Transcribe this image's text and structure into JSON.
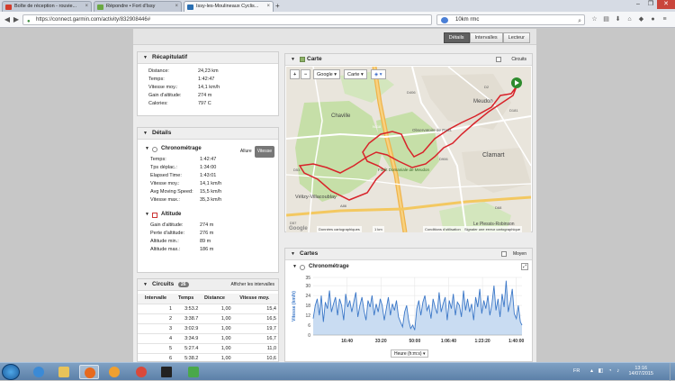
{
  "browser": {
    "tabs": [
      {
        "label": "Boîte de réception - rouvie...",
        "color": "#d23c2c"
      },
      {
        "label": "Répondre • Fort d'Issy",
        "color": "#6aa843"
      },
      {
        "label": "Issy-les-Moulineaux Cyclis...",
        "color": "#2a6fb2"
      }
    ],
    "new_tab": "+",
    "url": "https://connect.garmin.com/activity/832908446#",
    "search": "10km rmc",
    "win_min": "–",
    "win_max": "❐",
    "win_close": "✕"
  },
  "view_buttons": [
    "Détails",
    "Intervalles",
    "Lecteur"
  ],
  "recap": {
    "title": "Récapitulatif",
    "rows": [
      {
        "k": "Distance:",
        "v": "24,23 km"
      },
      {
        "k": "Temps:",
        "v": "1:42:47"
      },
      {
        "k": "Vitesse moy.:",
        "v": "14,1 km/h"
      },
      {
        "k": "Gain d'altitude:",
        "v": "274 m"
      },
      {
        "k": "Calories:",
        "v": "797 C"
      }
    ]
  },
  "details": {
    "title": "Détails",
    "chrono": {
      "title": "Chronométrage",
      "toggle": [
        "Allure",
        "Vitesse"
      ],
      "rows": [
        {
          "k": "Temps:",
          "v": "1:42:47"
        },
        {
          "k": "Tps déplac.:",
          "v": "1:34:00"
        },
        {
          "k": "Elapsed Time:",
          "v": "1:43:01"
        },
        {
          "k": "Vitesse moy.:",
          "v": "14,1 km/h"
        },
        {
          "k": "Avg Moving Speed:",
          "v": "15,5 km/h"
        },
        {
          "k": "Vitesse max.:",
          "v": "35,3 km/h"
        }
      ]
    },
    "altitude": {
      "title": "Altitude",
      "rows": [
        {
          "k": "Gain d'altitude:",
          "v": "274 m"
        },
        {
          "k": "Perte d'altitude:",
          "v": "276 m"
        },
        {
          "k": "Altitude min.:",
          "v": "89 m"
        },
        {
          "k": "Altitude max.:",
          "v": "186 m"
        }
      ]
    }
  },
  "circuits": {
    "title": "Circuits",
    "count": "26",
    "show_label": "Afficher les intervalles",
    "headers": [
      "Intervalle",
      "Temps",
      "Distance",
      "Vitesse moy."
    ],
    "rows": [
      [
        "1",
        "3:53.2",
        "1,00",
        "15,4"
      ],
      [
        "2",
        "3:38.7",
        "1,00",
        "16,5"
      ],
      [
        "3",
        "3:02.9",
        "1,00",
        "19,7"
      ],
      [
        "4",
        "3:34.9",
        "1,00",
        "16,7"
      ],
      [
        "5",
        "5:27.4",
        "1,00",
        "11,0"
      ],
      [
        "6",
        "5:38.2",
        "1,00",
        "10,6"
      ]
    ]
  },
  "map": {
    "title": "Carte",
    "circuits_label": "Circuits",
    "provider": "Google",
    "type": "Carte",
    "zoom_in": "+",
    "zoom_out": "−",
    "places": [
      {
        "name": "Meudon"
      },
      {
        "name": "Chaville"
      },
      {
        "name": "Clamart"
      },
      {
        "name": "Vélizy-Villacoublay"
      },
      {
        "name": "Observatoire de Paris"
      },
      {
        "name": "Forêt Domaniale de Meudon"
      },
      {
        "name": "Le Plessis-Robinson"
      }
    ],
    "roads": [
      "D406",
      "D2",
      "D181",
      "N118",
      "A86",
      "D57",
      "D53",
      "D906",
      "D68"
    ],
    "attrib_data": "Données cartographiques",
    "attrib_scale": "1 km",
    "attrib_terms": "Conditions d'utilisation",
    "attrib_report": "Signaler une erreur cartographique",
    "logo": "Google",
    "route_color": "#d8232a",
    "start_color": "#2e8b2e"
  },
  "charts": {
    "title": "Cartes",
    "average_label": "Moyen",
    "sub_title": "Chronométrage",
    "x_select": "Heure (h:m:s)"
  },
  "chart_data": {
    "type": "area",
    "ylabel": "Vitesse (km/h)",
    "xlabel": "Heure (h:m:s)",
    "ylim": [
      0,
      35
    ],
    "yticks": [
      0,
      6,
      12,
      18,
      24,
      30,
      35
    ],
    "xlim": [
      0,
      6168
    ],
    "xticks": [
      {
        "label": "16:40",
        "t": 1000
      },
      {
        "label": "33:20",
        "t": 2000
      },
      {
        "label": "50:00",
        "t": 3000
      },
      {
        "label": "1:06:40",
        "t": 4000
      },
      {
        "label": "1:23:20",
        "t": 5000
      },
      {
        "label": "1:40:00",
        "t": 6000
      }
    ],
    "color": "#3c78c8",
    "fill": "#c9dcf2",
    "x": [
      0,
      60,
      120,
      180,
      240,
      300,
      360,
      420,
      480,
      540,
      600,
      660,
      720,
      780,
      840,
      900,
      960,
      1020,
      1080,
      1140,
      1200,
      1260,
      1320,
      1380,
      1440,
      1500,
      1560,
      1620,
      1680,
      1740,
      1800,
      1860,
      1920,
      1980,
      2040,
      2100,
      2160,
      2220,
      2280,
      2340,
      2400,
      2460,
      2520,
      2580,
      2640,
      2700,
      2760,
      2820,
      2880,
      2940,
      3000,
      3060,
      3120,
      3180,
      3240,
      3300,
      3360,
      3420,
      3480,
      3540,
      3600,
      3660,
      3720,
      3780,
      3840,
      3900,
      3960,
      4020,
      4080,
      4140,
      4200,
      4260,
      4320,
      4380,
      4440,
      4500,
      4560,
      4620,
      4680,
      4740,
      4800,
      4860,
      4920,
      4980,
      5040,
      5100,
      5160,
      5220,
      5280,
      5340,
      5400,
      5460,
      5520,
      5580,
      5640,
      5700,
      5760,
      5820,
      5880,
      5940,
      6000,
      6060,
      6120,
      6168
    ],
    "values": [
      10,
      18,
      22,
      12,
      24,
      8,
      20,
      16,
      27,
      14,
      19,
      23,
      12,
      22,
      18,
      9,
      25,
      17,
      21,
      14,
      20,
      26,
      11,
      18,
      23,
      15,
      9,
      21,
      17,
      24,
      12,
      19,
      14,
      22,
      18,
      9,
      16,
      23,
      12,
      19,
      15,
      21,
      11,
      8,
      5,
      14,
      18,
      9,
      4,
      6,
      3,
      16,
      21,
      12,
      20,
      24,
      15,
      18,
      10,
      22,
      17,
      13,
      26,
      14,
      19,
      23,
      9,
      21,
      16,
      25,
      12,
      20,
      18,
      11,
      27,
      15,
      22,
      14,
      19,
      9,
      23,
      17,
      28,
      13,
      21,
      16,
      24,
      12,
      19,
      30,
      15,
      22,
      11,
      25,
      17,
      33,
      14,
      20,
      28,
      13,
      10,
      18,
      8,
      6
    ]
  },
  "taskbar": {
    "lang": "FR",
    "time": "13:16",
    "date": "14/07/2015"
  }
}
